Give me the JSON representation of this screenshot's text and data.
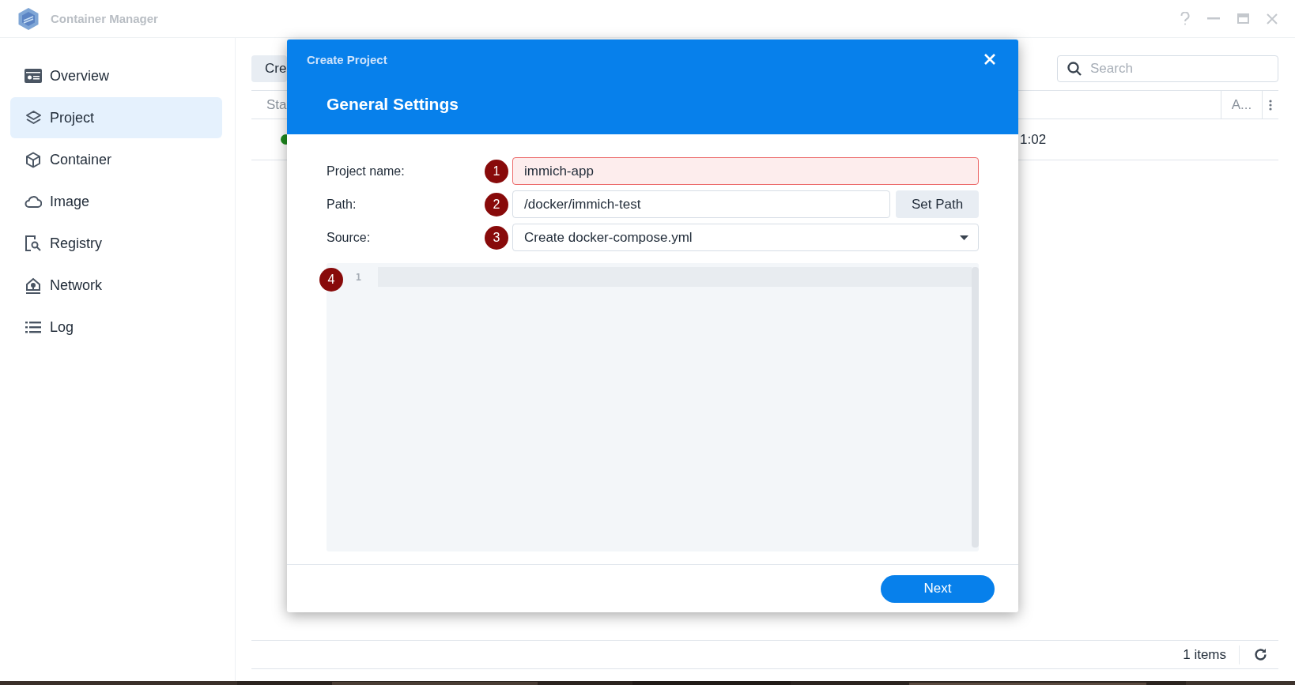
{
  "app": {
    "title": "Container Manager"
  },
  "sidebar": {
    "items": [
      {
        "label": "Overview",
        "selected": false
      },
      {
        "label": "Project",
        "selected": true
      },
      {
        "label": "Container",
        "selected": false
      },
      {
        "label": "Image",
        "selected": false
      },
      {
        "label": "Registry",
        "selected": false
      },
      {
        "label": "Network",
        "selected": false
      },
      {
        "label": "Log",
        "selected": false
      }
    ]
  },
  "toolbar": {
    "create_button": "Cre",
    "search": {
      "placeholder": "Search"
    }
  },
  "table": {
    "columns": [
      "Sta",
      "A..."
    ],
    "rows": [
      {
        "color": "#1e8a1e",
        "column_3": "1:02"
      }
    ]
  },
  "footer": {
    "count": "1 items"
  },
  "dialog": {
    "title": "Create Project",
    "heading": "General Settings",
    "fields": [
      {
        "kind": "text",
        "label": "Project name:",
        "badge": "1",
        "value": "immich-app",
        "invalid": true
      },
      {
        "kind": "path",
        "label": "Path:",
        "badge": "2",
        "value": "/docker/immich-test",
        "button": "Set Path",
        "invalid": false
      },
      {
        "kind": "select",
        "label": "Source:",
        "badge": "3",
        "value": "Create docker-compose.yml",
        "invalid": false
      }
    ],
    "editor": {
      "badge": "4",
      "line_numbers": [
        "1"
      ]
    },
    "next_button": "Next"
  }
}
